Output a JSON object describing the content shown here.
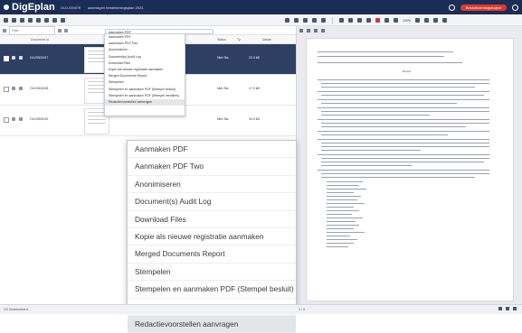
{
  "titlebar": {
    "app": "DigEplan",
    "user": "OLD-ID0676",
    "document": "aanvragen bestemmingsplan 2021",
    "pill": "Besluitvormingstraject"
  },
  "toolbar": {
    "zoom": "100%"
  },
  "filter": {
    "placeholder": "Filter"
  },
  "columns": [
    "Document id",
    "Status",
    "Ty",
    "Datum"
  ],
  "rows": [
    {
      "id": "OLV0001917",
      "c1": "Niet Sta",
      "c2": "22.0 kB",
      "selected": true
    },
    {
      "id": "OLV0001918",
      "c1": "Niet Sta",
      "c2": "17.3 kB",
      "selected": false
    },
    {
      "id": "OLV0001919",
      "c1": "Niet Sta",
      "c2": "40.0 kB",
      "selected": false
    }
  ],
  "small_menu": {
    "top": "Aanmaken PDF",
    "items": [
      "Aanmaken PDF",
      "Aanmaken PDF Two",
      "Anonimiseren",
      "Document(s) Audit Log",
      "Download Files",
      "Kopie als nieuwe registratie aanmaken",
      "Merged Documents Report",
      "Stempelen",
      "Stempelen en aanmaken PDF (Stempel besluit)",
      "Stempelen en aanmaken PDF (Stempel vervallen)",
      "Redactievoorstellen aanvragen"
    ]
  },
  "big_menu": {
    "items": [
      "Aanmaken PDF",
      "Aanmaken PDF Two",
      "Anonimiseren",
      "Document(s) Audit Log",
      "Download Files",
      "Kopie als nieuwe registratie aanmaken",
      "Merged Documents Report",
      "Stempelen",
      "Stempelen en aanmaken PDF (Stempel besluit)",
      "Stempelen en aanmaken PDF (Stempel vervallen)",
      "Redactievoorstellen aanvragen"
    ],
    "highlighted_index": 10
  },
  "preview": {
    "heading": "Besluit:"
  },
  "status": {
    "left": "1/3 Geselecteerd",
    "middle": "1 / 3"
  }
}
